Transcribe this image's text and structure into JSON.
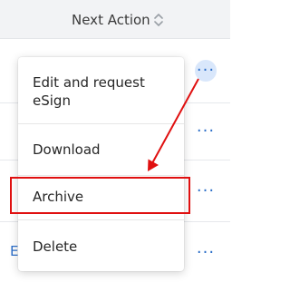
{
  "table": {
    "column_header": "Next Action",
    "sort_icon": "sort-updown-icon",
    "partial_row_text": "E",
    "row_action_icon": "more-horizontal-icon"
  },
  "menu": {
    "items": [
      {
        "label": "Edit and request eSign"
      },
      {
        "label": "Download"
      },
      {
        "label": "Archive"
      },
      {
        "label": "Delete"
      }
    ]
  },
  "annotation": {
    "color": "#e01010"
  }
}
